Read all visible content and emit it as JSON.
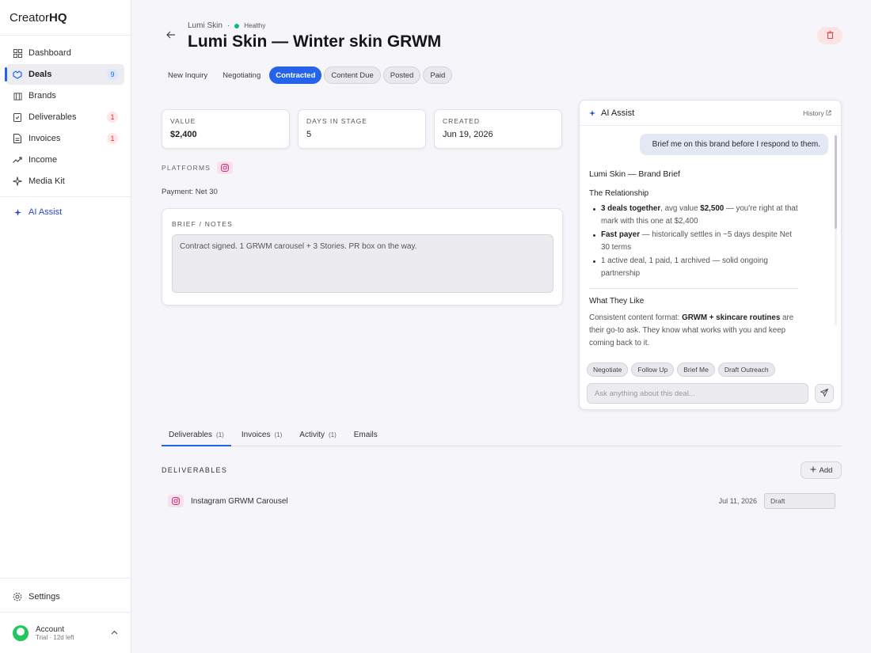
{
  "app": {
    "logo_main": "Creator",
    "logo_bold": "HQ"
  },
  "sidebar": {
    "items": [
      {
        "label": "Dashboard",
        "icon": "grid-icon"
      },
      {
        "label": "Deals",
        "icon": "handshake-icon",
        "badge": "9"
      },
      {
        "label": "Brands",
        "icon": "building-icon"
      },
      {
        "label": "Deliverables",
        "icon": "clipboard-icon",
        "badge": "1"
      },
      {
        "label": "Invoices",
        "icon": "file-icon",
        "badge": "1"
      },
      {
        "label": "Income",
        "icon": "trend-icon"
      },
      {
        "label": "Media Kit",
        "icon": "sparkle-icon"
      }
    ],
    "ai_assist": "AI Assist",
    "settings": "Settings",
    "account": {
      "name": "Account",
      "sub": "Trial · 12d left"
    }
  },
  "header": {
    "brand": "Lumi Skin",
    "separator": "·",
    "health": "Healthy",
    "title": "Lumi Skin — Winter skin GRWM"
  },
  "stages": [
    "New Inquiry",
    "Negotiating",
    "Contracted",
    "Content Due",
    "Posted",
    "Paid"
  ],
  "stats": {
    "value_label": "VALUE",
    "value": "$2,400",
    "days_label": "DAYS IN STAGE",
    "days": "5",
    "created_label": "CREATED",
    "created": "Jun 19, 2026"
  },
  "platforms_label": "PLATFORMS",
  "payment": "Payment: Net 30",
  "brief": {
    "label": "BRIEF / NOTES",
    "text": "Contract signed. 1 GRWM carousel + 3 Stories. PR box on the way."
  },
  "ai": {
    "title": "AI Assist",
    "history": "History",
    "user_message": "Brief me on this brand before I respond to them.",
    "brief_title": "Lumi Skin — Brand Brief",
    "section1": "The Relationship",
    "b1_bold": "3 deals together",
    "b1_mid": ", avg value ",
    "b1_bold2": "$2,500",
    "b1_rest": " — you're right at that mark with this one at $2,400",
    "b2_bold": "Fast payer",
    "b2_rest": " — historically settles in ~5 days despite Net 30 terms",
    "b3": "1 active deal, 1 paid, 1 archived — solid ongoing partnership",
    "section2": "What They Like",
    "p1_a": "Consistent content format: ",
    "p1_bold": "GRWM + skincare routines",
    "p1_b": " are their go-to ask. They know what works with you and keep coming back to it.",
    "actions": [
      "Negotiate",
      "Follow Up",
      "Brief Me",
      "Draft Outreach"
    ],
    "input_placeholder": "Ask anything about this deal..."
  },
  "tabs": [
    {
      "label": "Deliverables",
      "count": "(1)"
    },
    {
      "label": "Invoices",
      "count": "(1)"
    },
    {
      "label": "Activity",
      "count": "(1)"
    },
    {
      "label": "Emails",
      "count": ""
    }
  ],
  "deliverables": {
    "label": "DELIVERABLES",
    "add": "Add",
    "rows": [
      {
        "name": "Instagram GRWM Carousel",
        "date": "Jul 11, 2026",
        "status": "Draft"
      }
    ]
  },
  "colors": {
    "accent": "#2563eb",
    "healthy": "#10b981",
    "danger": "#e0474c",
    "instagram": "#c13584"
  }
}
